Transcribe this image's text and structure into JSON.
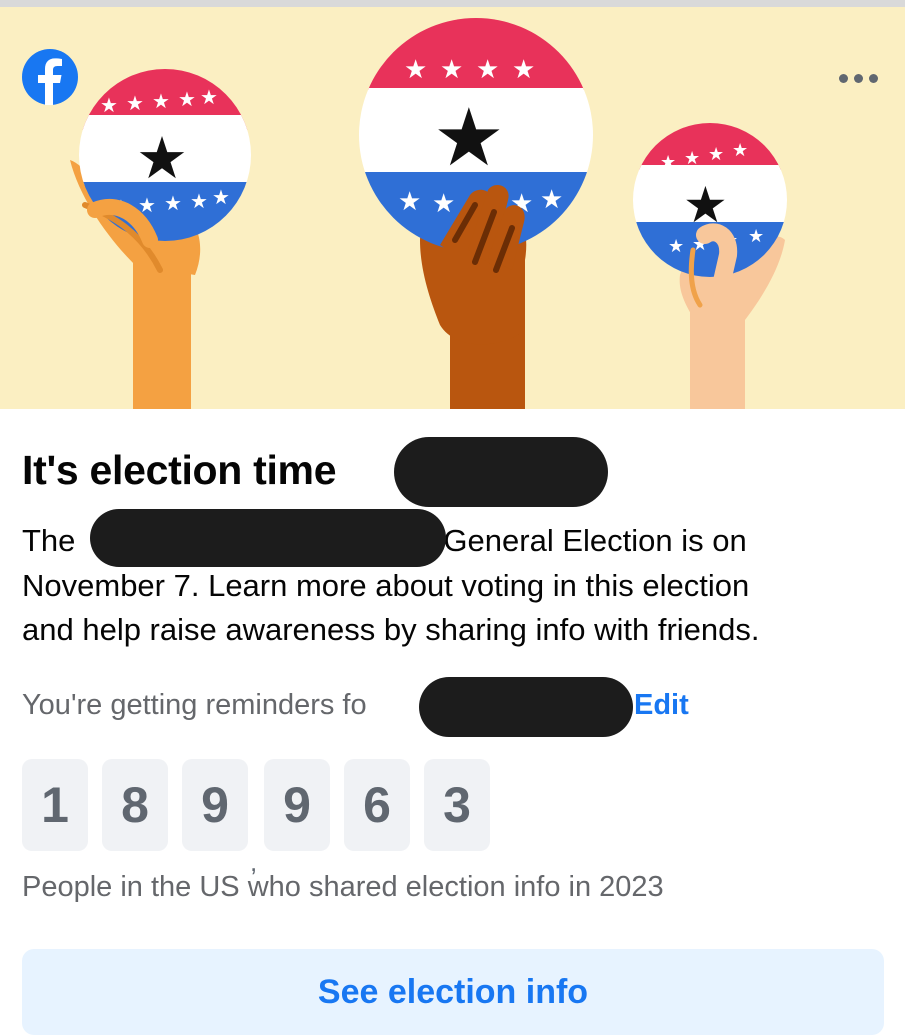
{
  "colors": {
    "brand_blue": "#1877f2",
    "banner_bg": "#fbefc2",
    "button_bg": "#e7f3ff",
    "badge_red": "#e8325a",
    "badge_blue": "#2f6fd6"
  },
  "icons": {
    "logo": "facebook-logo-icon",
    "more": "more-horizontal-icon"
  },
  "card": {
    "title": "It's election time",
    "body_line1_start": "The",
    "body_line1_end": "General Election is on",
    "body_line2": "November 7. Learn more about voting in this election",
    "body_line3": "and help raise awareness by sharing info with friends.",
    "reminder_text": "You're getting reminders fo",
    "edit_label": "Edit",
    "counter_digits": [
      "1",
      "8",
      "9",
      "9",
      "6",
      "3"
    ],
    "counter_separator": ",",
    "counter_caption": "People in the US who shared election info in 2023",
    "cta_label": "See election info"
  }
}
